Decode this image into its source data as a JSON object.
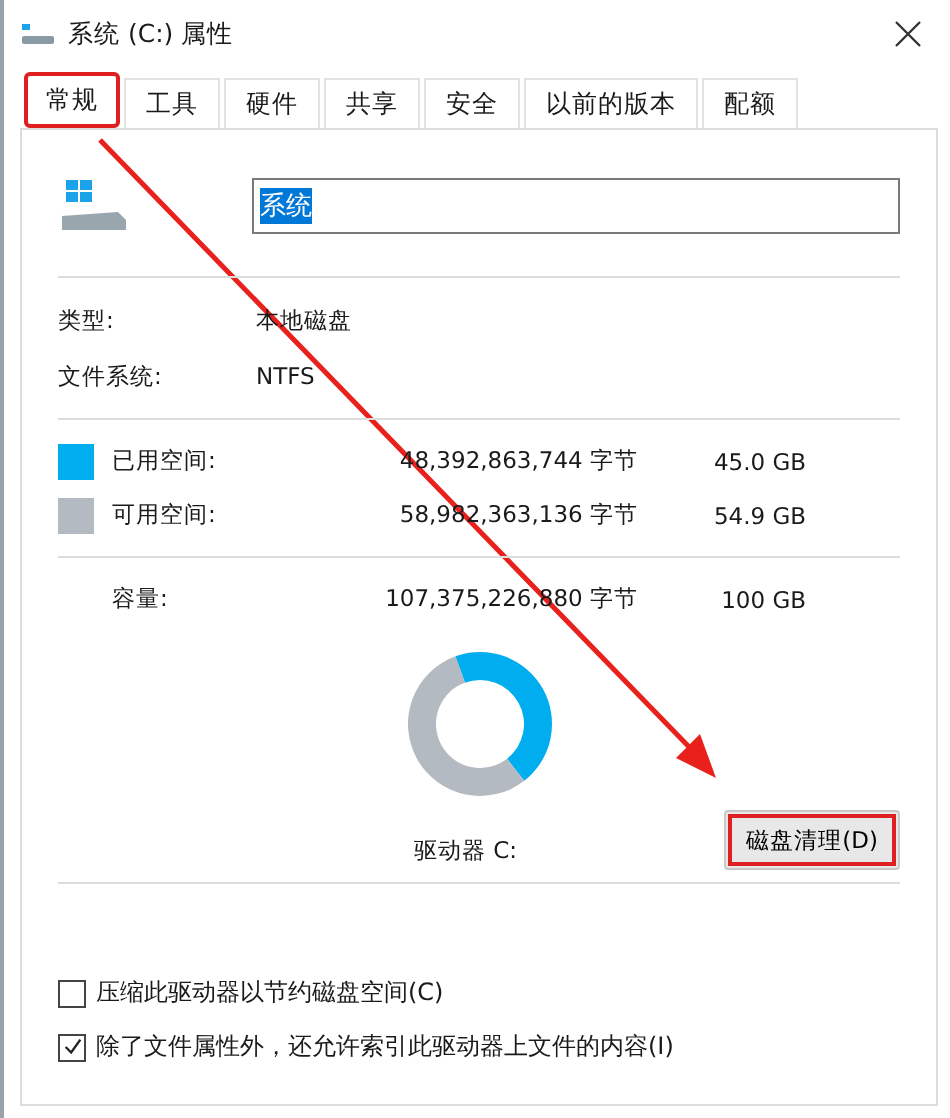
{
  "window": {
    "title": "系统 (C:) 属性"
  },
  "tabs": [
    {
      "label": "常规",
      "selected": true,
      "highlighted": true
    },
    {
      "label": "工具",
      "selected": false,
      "highlighted": false
    },
    {
      "label": "硬件",
      "selected": false,
      "highlighted": false
    },
    {
      "label": "共享",
      "selected": false,
      "highlighted": false
    },
    {
      "label": "安全",
      "selected": false,
      "highlighted": false
    },
    {
      "label": "以前的版本",
      "selected": false,
      "highlighted": false
    },
    {
      "label": "配额",
      "selected": false,
      "highlighted": false
    }
  ],
  "name_field": {
    "value": "系统"
  },
  "info": [
    {
      "label": "类型:",
      "value": "本地磁盘"
    },
    {
      "label": "文件系统:",
      "value": "NTFS"
    }
  ],
  "space": [
    {
      "label": "已用空间:",
      "bytes": "48,392,863,744 字节",
      "size": "45.0 GB",
      "color": "#00adef"
    },
    {
      "label": "可用空间:",
      "bytes": "58,982,363,136 字节",
      "size": "54.9 GB",
      "color": "#b4bac1"
    }
  ],
  "capacity": {
    "label": "容量:",
    "bytes": "107,375,226,880 字节",
    "size": "100 GB"
  },
  "chart_data": {
    "type": "donut",
    "values": [
      45.0,
      54.9
    ]
  },
  "drive_label": "驱动器 C:",
  "cleanup_button": {
    "label": "磁盘清理(D)",
    "highlighted": true
  },
  "options": [
    {
      "label": "压缩此驱动器以节约磁盘空间(C)",
      "checked": false
    },
    {
      "label": "除了文件属性外，还允许索引此驱动器上文件的内容(I)",
      "checked": true
    }
  ]
}
